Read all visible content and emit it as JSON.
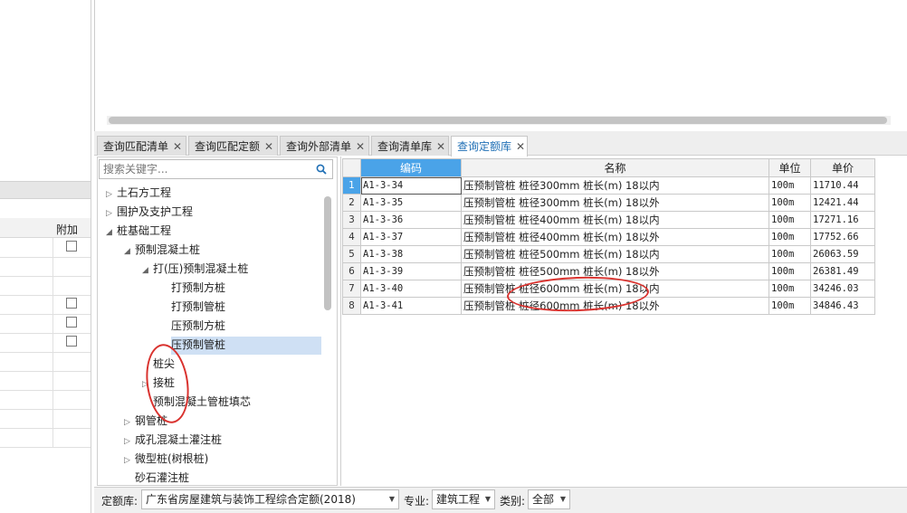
{
  "left": {
    "header_label": "附加",
    "checkbox_rows": [
      true,
      false,
      false,
      true,
      true,
      true,
      false,
      false,
      false,
      false,
      false
    ]
  },
  "tabs": [
    {
      "label": "查询匹配清单",
      "active": false
    },
    {
      "label": "查询匹配定额",
      "active": false
    },
    {
      "label": "查询外部清单",
      "active": false
    },
    {
      "label": "查询清单库",
      "active": false
    },
    {
      "label": "查询定额库",
      "active": true
    }
  ],
  "tab_close_glyph": "✕",
  "search": {
    "placeholder": "搜索关键字...",
    "value": ""
  },
  "tree": [
    {
      "label": "土石方工程",
      "expanded": false,
      "has_children": true
    },
    {
      "label": "围护及支护工程",
      "expanded": false,
      "has_children": true
    },
    {
      "label": "桩基础工程",
      "expanded": true,
      "has_children": true
    },
    {
      "label": "预制混凝土桩",
      "expanded": true,
      "has_children": true
    },
    {
      "label": "打(压)预制混凝土桩",
      "expanded": true,
      "has_children": true
    },
    {
      "label": "打预制方桩",
      "has_children": false
    },
    {
      "label": "打预制管桩",
      "has_children": false
    },
    {
      "label": "压预制方桩",
      "has_children": false
    },
    {
      "label": "压预制管桩",
      "has_children": false,
      "selected": true
    },
    {
      "label": "桩尖",
      "has_children": false
    },
    {
      "label": "接桩",
      "expanded": false,
      "has_children": true
    },
    {
      "label": "预制混凝土管桩填芯",
      "has_children": false
    },
    {
      "label": "钢管桩",
      "expanded": false,
      "has_children": true
    },
    {
      "label": "成孔混凝土灌注桩",
      "expanded": false,
      "has_children": true
    },
    {
      "label": "微型桩(树根桩)",
      "expanded": false,
      "has_children": true
    },
    {
      "label": "砂石灌注桩",
      "has_children": false
    }
  ],
  "grid": {
    "columns": [
      "编码",
      "名称",
      "单位",
      "单价"
    ],
    "rows": [
      {
        "idx": "1",
        "code": "A1-3-34",
        "name": "压预制管桩 桩径300mm 桩长(m) 18以内",
        "unit": "100m",
        "price": "11710.44"
      },
      {
        "idx": "2",
        "code": "A1-3-35",
        "name": "压预制管桩 桩径300mm 桩长(m) 18以外",
        "unit": "100m",
        "price": "12421.44"
      },
      {
        "idx": "3",
        "code": "A1-3-36",
        "name": "压预制管桩 桩径400mm 桩长(m) 18以内",
        "unit": "100m",
        "price": "17271.16"
      },
      {
        "idx": "4",
        "code": "A1-3-37",
        "name": "压预制管桩 桩径400mm 桩长(m) 18以外",
        "unit": "100m",
        "price": "17752.66"
      },
      {
        "idx": "5",
        "code": "A1-3-38",
        "name": "压预制管桩 桩径500mm 桩长(m) 18以内",
        "unit": "100m",
        "price": "26063.59"
      },
      {
        "idx": "6",
        "code": "A1-3-39",
        "name": "压预制管桩 桩径500mm 桩长(m) 18以外",
        "unit": "100m",
        "price": "26381.49"
      },
      {
        "idx": "7",
        "code": "A1-3-40",
        "name": "压预制管桩 桩径600mm 桩长(m) 18以内",
        "unit": "100m",
        "price": "34246.03"
      },
      {
        "idx": "8",
        "code": "A1-3-41",
        "name": "压预制管桩 桩径600mm 桩长(m) 18以外",
        "unit": "100m",
        "price": "34846.43"
      }
    ]
  },
  "bottom": {
    "quota_label": "定额库:",
    "quota_value": "广东省房屋建筑与装饰工程综合定额(2018)",
    "major_label": "专业:",
    "major_value": "建筑工程",
    "category_label": "类别:",
    "category_value": "全部"
  },
  "colors": {
    "accent": "#4aa3e8",
    "selection": "#cfe0f4",
    "annotation": "#d9322e",
    "active_tab_text": "#1f6fb5"
  },
  "icons": {
    "search": "search-icon",
    "expand": "triangle-right-icon",
    "collapse": "triangle-down-icon",
    "dropdown": "caret-down-icon"
  }
}
